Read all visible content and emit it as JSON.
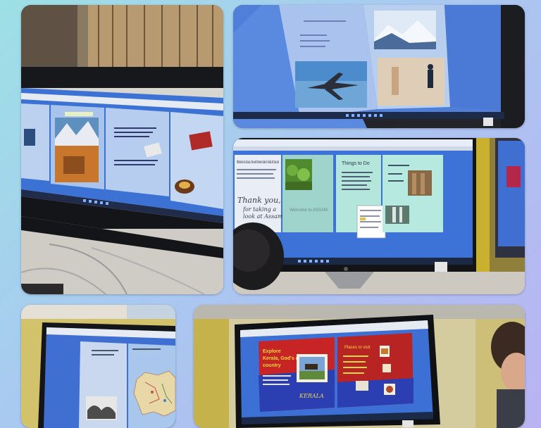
{
  "collage": {
    "tiles": [
      {
        "id": "tile-1",
        "description_hidden": true
      },
      {
        "id": "tile-2"
      },
      {
        "id": "tile-3"
      },
      {
        "id": "tile-4"
      },
      {
        "id": "tile-5"
      }
    ]
  },
  "screens": {
    "tile3": {
      "welcome_text": "Welcome to Assam, the well known state in India for tea etc",
      "thank_you": "Thank you,",
      "thank_you_2": "for taking a",
      "thank_you_3": "look at Assam",
      "things_to_do": "Things to Do",
      "welcome_banner": "Welcome to ASSAM"
    },
    "tile5": {
      "heading_line1": "Explore",
      "heading_line2": "Kerala, God's own",
      "heading_line3": "country",
      "place_label": "KERALA",
      "right_title": "Places to visit"
    }
  },
  "colors": {
    "background_start": "#9de0e6",
    "background_end": "#b9b3f2",
    "slide_blue": "#a9cbee",
    "monitor_black": "#111318",
    "kerala_red": "#c52424",
    "kerala_blue": "#2d3fb0"
  }
}
